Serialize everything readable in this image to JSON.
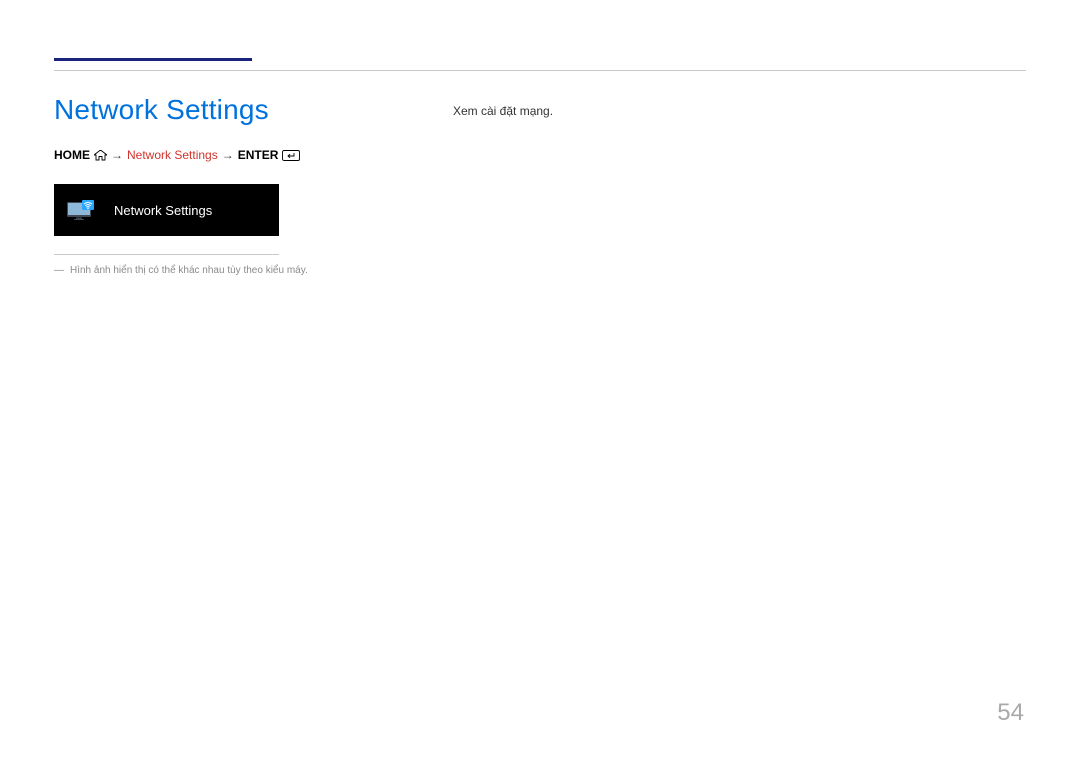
{
  "header": {
    "title": "Network Settings"
  },
  "breadcrumb": {
    "home_label": "HOME",
    "current": "Network Settings",
    "enter_label": "ENTER"
  },
  "menu_card": {
    "label": "Network Settings"
  },
  "caption": {
    "note": "Hình ảnh hiển thị có thể khác nhau tùy theo kiểu máy."
  },
  "body": {
    "text": "Xem cài đặt mạng."
  },
  "page_number": "54"
}
